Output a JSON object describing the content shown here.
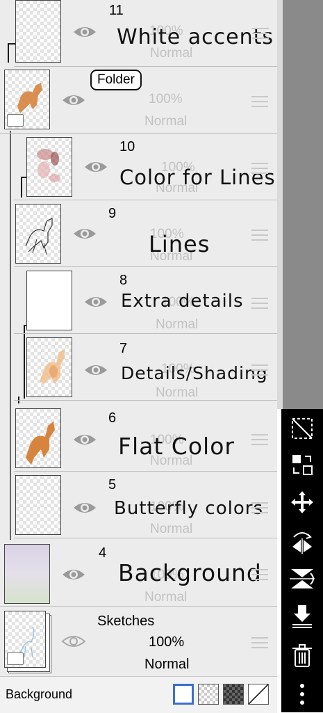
{
  "layers": [
    {
      "number": "11",
      "name": "White accents",
      "opacity": "100%",
      "blend": "Normal",
      "visibility_icon": "eye-icon",
      "thumbnail": "empty"
    },
    {
      "type": "folder",
      "name": "Folder",
      "opacity": "100%",
      "blend": "Normal",
      "visibility_icon": "eye-icon",
      "thumbnail": "horse-sketch-color"
    },
    {
      "number": "10",
      "name": "Color for Lines",
      "opacity": "100%",
      "blend": "Normal",
      "visibility_icon": "eye-icon",
      "thumbnail": "colored-lines"
    },
    {
      "number": "9",
      "name": "Lines",
      "opacity": "100%",
      "blend": "Normal",
      "visibility_icon": "eye-icon",
      "thumbnail": "line-art"
    },
    {
      "number": "8",
      "name": "Extra details",
      "opacity": "100%",
      "blend": "Normal",
      "visibility_icon": "eye-icon",
      "thumbnail": "empty"
    },
    {
      "number": "7",
      "name": "Details/Shading",
      "opacity": "100%",
      "blend": "Normal",
      "visibility_icon": "eye-icon",
      "thumbnail": "shading"
    },
    {
      "number": "6",
      "name": "Flat Color",
      "opacity": "100%",
      "blend": "Normal",
      "visibility_icon": "eye-icon",
      "thumbnail": "flat-horse"
    },
    {
      "number": "5",
      "name": "Butterfly colors",
      "opacity": "100%",
      "blend": "Normal",
      "visibility_icon": "eye-icon",
      "thumbnail": "empty"
    },
    {
      "number": "4",
      "name": "Background",
      "opacity": "100%",
      "blend": "Normal",
      "visibility_icon": "eye-icon",
      "thumbnail": "purple-green-gradient"
    },
    {
      "type": "folder",
      "name": "Sketches",
      "opacity": "100%",
      "blend": "Normal",
      "visibility_icon": "eye-icon",
      "thumbnail": "sketch-folder"
    }
  ],
  "background": {
    "label": "Background",
    "options": [
      "white",
      "transparent",
      "dark-checker",
      "none"
    ],
    "selected": "white"
  },
  "toolbar": [
    "deselect-icon",
    "swap-icon",
    "move-icon",
    "flip-horizontal-icon",
    "flip-vertical-icon",
    "merge-down-icon",
    "trash-icon",
    "more-icon"
  ],
  "colors": {
    "panel_bg": "#ececec",
    "toolbar_bg": "#000000",
    "selected_swatch_border": "#3b6fd1",
    "orange_horse": "#d7843f"
  }
}
